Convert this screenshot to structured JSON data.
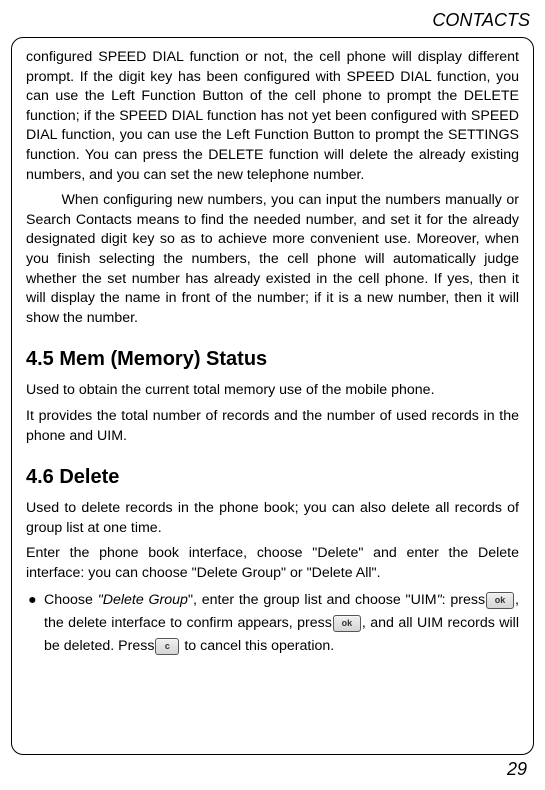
{
  "header": "CONTACTS",
  "page_number": "29",
  "para1": "configured SPEED DIAL function or not, the cell phone will display different prompt. If the digit key has been configured with SPEED DIAL function, you can use the Left Function Button of the cell phone to prompt the DELETE function; if the SPEED DIAL function has not yet been configured with SPEED DIAL function, you can use the Left Function Button to prompt the SETTINGS function. You can press the DELETE function will delete the already existing numbers, and you can set the new telephone number.",
  "para2": "When configuring new numbers, you can input the numbers manually or Search Contacts means to find the needed number, and set it for the already designated digit key so as to achieve more convenient use. Moreover, when you finish selecting the numbers, the cell phone will automatically judge whether the set number has already existed in the cell phone. If yes, then it will display the name in front of the number; if it is a new number, then it will show the number.",
  "section_45_heading": "4.5 Mem (Memory) Status",
  "section_45_p1": "Used to obtain the current total memory use of the mobile phone.",
  "section_45_p2": "It provides the total number of records and the number of used records in the phone and UIM.",
  "section_46_heading": "4.6 Delete",
  "section_46_p1": "Used to delete records in the phone book; you can also delete all records of group list at one time.",
  "section_46_p2": "Enter the phone book interface, choose \"Delete\" and enter the Delete interface: you can choose \"Delete Group\" or \"Delete All\".",
  "bullet": {
    "prefix": "Choose ",
    "italic_part1": "\"Delete Group",
    "after_italic1": "\", enter the group list and choose \"UIM",
    "italic_part2": "\"",
    "after_italic2": ": press",
    "seg2": ", the delete interface to confirm appears, press",
    "seg3": ", and all UIM records will be deleted. Press",
    "seg4": " to cancel this operation."
  },
  "keys": {
    "ok": "ok",
    "c": "c"
  }
}
